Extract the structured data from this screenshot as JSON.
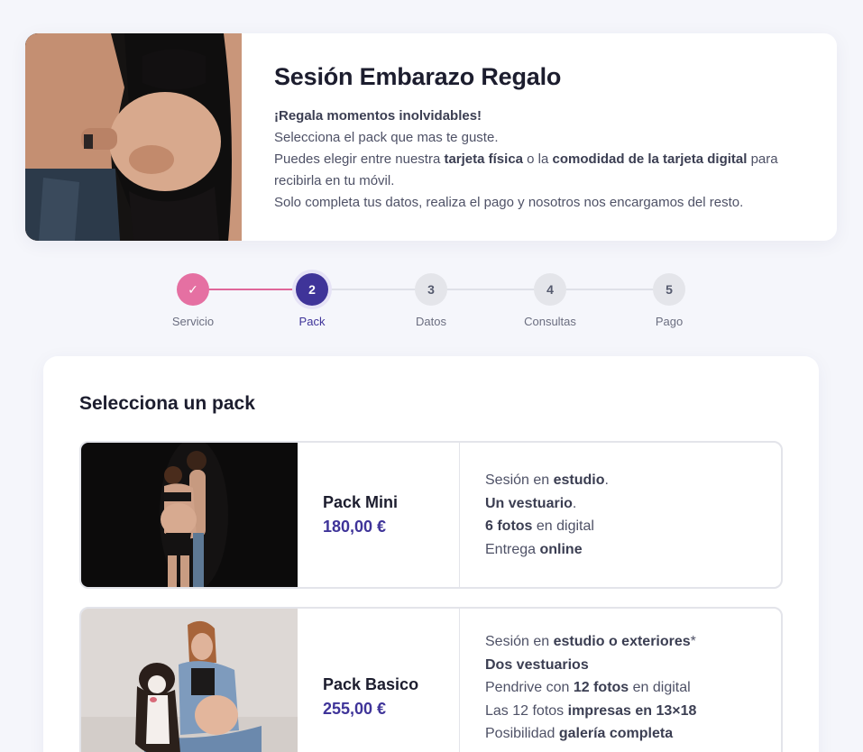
{
  "hero": {
    "title": "Sesión Embarazo Regalo",
    "lead": "¡Regala momentos inolvidables!",
    "line1": "Selecciona el pack que mas te guste.",
    "line2_a": "Puedes elegir entre nuestra ",
    "line2_b": "tarjeta física",
    "line2_c": " o la ",
    "line2_d": "comodidad de la tarjeta digital",
    "line2_e": " para recibirla en tu móvil.",
    "line3": "Solo completa tus datos, realiza el pago y nosotros nos encargamos del resto."
  },
  "stepper": {
    "steps": [
      {
        "number": "✓",
        "label": "Servicio"
      },
      {
        "number": "2",
        "label": "Pack"
      },
      {
        "number": "3",
        "label": "Datos"
      },
      {
        "number": "4",
        "label": "Consultas"
      },
      {
        "number": "5",
        "label": "Pago"
      }
    ]
  },
  "packs_section": {
    "title": "Selecciona un pack",
    "packs": [
      {
        "name": "Pack Mini",
        "price": "180,00 €",
        "features": [
          {
            "a": "Sesión en ",
            "b": "estudio",
            "c": "."
          },
          {
            "a": "",
            "b": "Un vestuario",
            "c": "."
          },
          {
            "a": "",
            "b": "6 fotos",
            "c": " en digital"
          },
          {
            "a": "Entrega ",
            "b": "online",
            "c": ""
          }
        ]
      },
      {
        "name": "Pack Basico",
        "price": "255,00 €",
        "features": [
          {
            "a": "Sesión en ",
            "b": "estudio o exteriores",
            "c": "*"
          },
          {
            "a": "",
            "b": "Dos vestuarios",
            "c": ""
          },
          {
            "a": "Pendrive con ",
            "b": "12 fotos",
            "c": " en digital"
          },
          {
            "a": "Las 12 fotos ",
            "b": "impresas en 13×18",
            "c": ""
          },
          {
            "a": "Posibilidad ",
            "b": "galería completa",
            "c": ""
          }
        ]
      }
    ]
  }
}
